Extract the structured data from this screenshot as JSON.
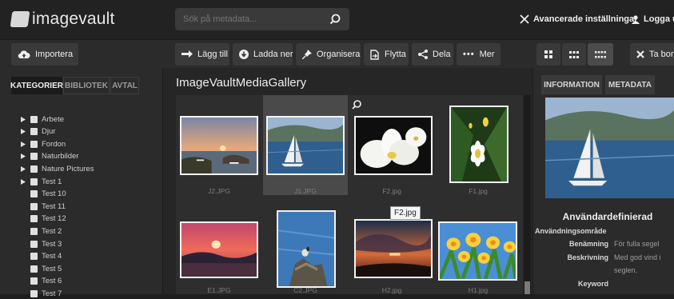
{
  "header": {
    "logo_text": "imagevault",
    "search_placeholder": "Sök på metadata...",
    "advanced_settings": "Avancerade inställningar",
    "logout": "Logga ut"
  },
  "toolbar": {
    "import": "Importera",
    "add": "Lägg till",
    "download": "Ladda ner",
    "organize": "Organisera",
    "move": "Flytta",
    "share": "Dela",
    "more": "Mer",
    "remove": "Ta bort"
  },
  "sidebar": {
    "tabs": [
      "KATEGORIER",
      "BIBLIOTEK",
      "AVTAL"
    ],
    "active_tab": 0,
    "items": [
      {
        "label": "Arbete",
        "expandable": true
      },
      {
        "label": "Djur",
        "expandable": true
      },
      {
        "label": "Fordon",
        "expandable": true
      },
      {
        "label": "Naturbilder",
        "expandable": true
      },
      {
        "label": "Nature Pictures",
        "expandable": true
      },
      {
        "label": "Test 1",
        "expandable": true
      },
      {
        "label": "Test 10",
        "expandable": false
      },
      {
        "label": "Test 11",
        "expandable": false
      },
      {
        "label": "Test 12",
        "expandable": false
      },
      {
        "label": "Test 2",
        "expandable": false
      },
      {
        "label": "Test 3",
        "expandable": false
      },
      {
        "label": "Test 4",
        "expandable": false
      },
      {
        "label": "Test 5",
        "expandable": false
      },
      {
        "label": "Test 6",
        "expandable": false
      },
      {
        "label": "Test 7",
        "expandable": false
      }
    ]
  },
  "gallery": {
    "title": "ImageVaultMediaGallery",
    "tooltip": "F2.jpg",
    "items": [
      {
        "name": "J2.JPG",
        "selected": false,
        "image": "sunset-harbor"
      },
      {
        "name": "J1.JPG",
        "selected": true,
        "image": "sailboat"
      },
      {
        "name": "F2.jpg",
        "selected": false,
        "image": "white-orchids"
      },
      {
        "name": "F1.jpg",
        "selected": false,
        "image": "white-flower"
      },
      {
        "name": "E1.JPG",
        "selected": false,
        "image": "red-sunset"
      },
      {
        "name": "C2.JPG",
        "selected": false,
        "image": "bird-on-rock"
      },
      {
        "name": "H2.jpg",
        "selected": false,
        "image": "dramatic-sky"
      },
      {
        "name": "H1.jpg",
        "selected": false,
        "image": "daffodils"
      }
    ]
  },
  "info_panel": {
    "tabs": [
      "INFORMATION",
      "METADATA"
    ],
    "section_title": "Användardefinierad",
    "area_label": "Användningsområde",
    "fields": [
      {
        "key": "Benämning",
        "value": "För fulla segel"
      },
      {
        "key": "Beskrivning",
        "value": "Med god vind i"
      },
      {
        "key": "",
        "value": "seglen."
      },
      {
        "key": "Keyword",
        "value": ""
      }
    ]
  },
  "colors": {
    "topbar": "#222222",
    "toolbar": "#2b2b2b",
    "selected_cell": "#4a4a4a"
  }
}
